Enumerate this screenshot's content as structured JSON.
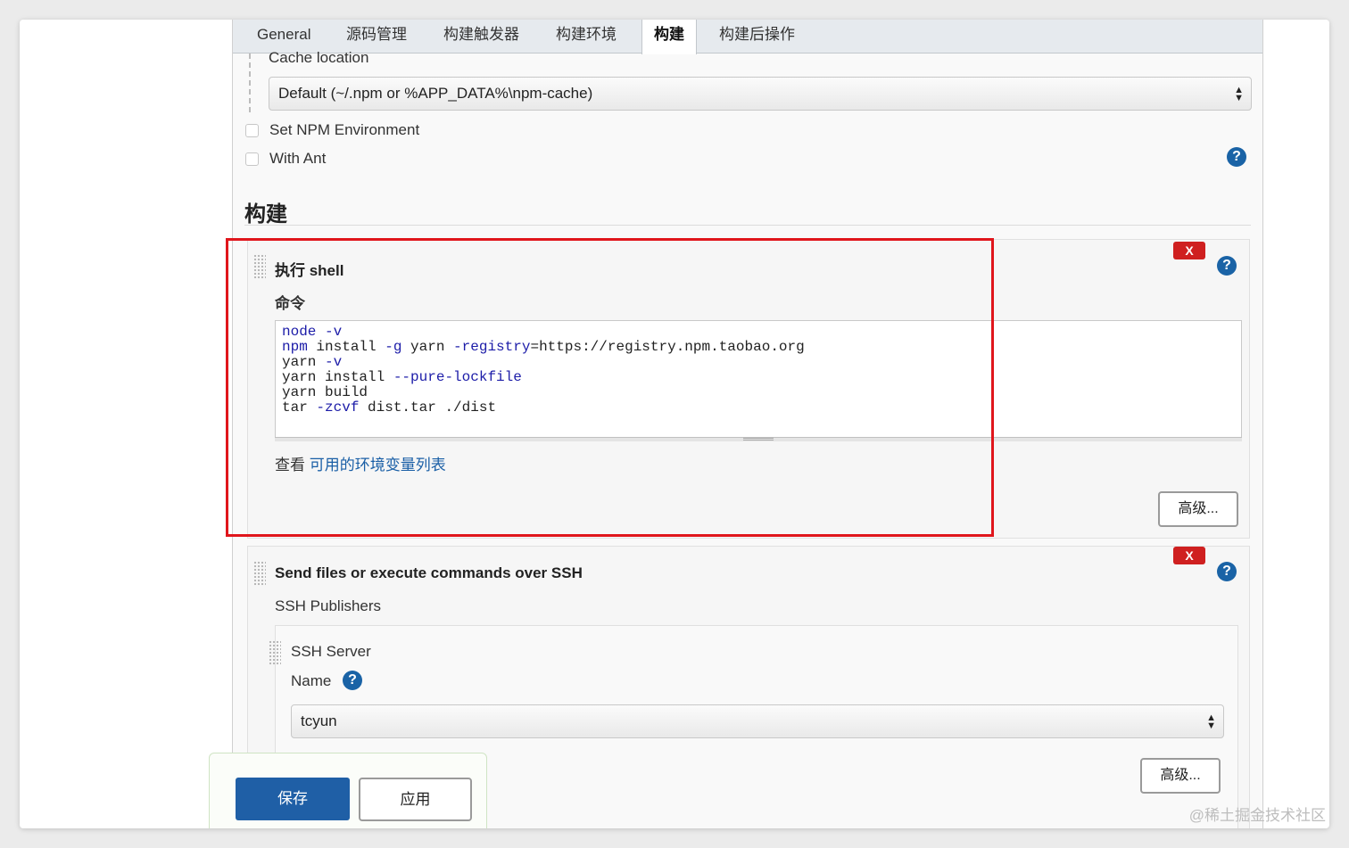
{
  "tabs": [
    "General",
    "源码管理",
    "构建触发器",
    "构建环境",
    "构建",
    "构建后操作"
  ],
  "active_tab": "构建",
  "npm": {
    "cache_label": "Cache location",
    "cache_value": "Default (~/.npm or %APP_DATA%\\npm-cache)",
    "set_env_label": "Set NPM Environment",
    "with_ant_label": "With Ant"
  },
  "build": {
    "section_title": "构建",
    "shell_step": {
      "title": "执行 shell",
      "command_label": "命令",
      "command_lines": [
        "node -v",
        "npm install -g yarn -registry=https://registry.npm.taobao.org",
        "yarn -v",
        "yarn install --pure-lockfile",
        "yarn build",
        "tar -zcvf dist.tar ./dist"
      ],
      "env_prefix": "查看",
      "env_link": "可用的环境变量列表",
      "advanced_label": "高级..."
    },
    "ssh_step": {
      "title": "Send files or execute commands over SSH",
      "publishers_label": "SSH Publishers",
      "server_label": "SSH Server",
      "name_label": "Name",
      "name_value": "tcyun",
      "advanced_label": "高级..."
    },
    "delete_label": "X",
    "help_glyph": "?"
  },
  "footer": {
    "save_label": "保存",
    "apply_label": "应用"
  },
  "watermark": "@稀土掘金技术社区",
  "colors": {
    "highlight_box": "#e0161c",
    "primary_button": "#1f5fa6",
    "delete_button": "#cf2020",
    "help_icon": "#1a63a6"
  }
}
